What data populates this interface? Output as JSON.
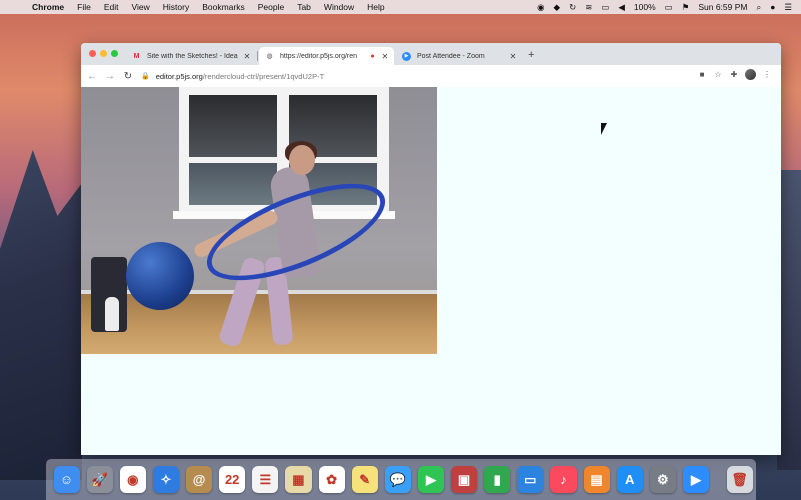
{
  "menubar": {
    "app_name": "Chrome",
    "items": [
      "File",
      "Edit",
      "View",
      "History",
      "Bookmarks",
      "People",
      "Tab",
      "Window",
      "Help"
    ],
    "battery": "100%",
    "clock": "Sun 6:59 PM"
  },
  "browser": {
    "tabs": [
      {
        "label": "Site with the Sketches! - Idea",
        "favicon": "gmail-icon",
        "active": false
      },
      {
        "label": "https://editor.p5js.org/ren",
        "favicon": "globe-icon",
        "active": true,
        "recording": true
      },
      {
        "label": "Post Attendee - Zoom",
        "favicon": "zoom-icon",
        "active": false
      }
    ],
    "new_tab_label": "+",
    "address": {
      "host": "editor.p5js.org",
      "path": "/rendercloud-ctrl/present/1qvdU2P-T"
    }
  },
  "page": {
    "background": "#f2fffe",
    "video_description_name": "webcam-video"
  },
  "dock": {
    "apps": [
      {
        "name": "finder-icon",
        "color": "#3d8ef0",
        "glyph": "☺"
      },
      {
        "name": "launchpad-icon",
        "color": "#8a8f9a",
        "glyph": "🚀"
      },
      {
        "name": "chrome-icon",
        "color": "#ffffff",
        "glyph": "◉"
      },
      {
        "name": "safari-icon",
        "color": "#2f7be0",
        "glyph": "✧"
      },
      {
        "name": "contacts-icon",
        "color": "#b58b4f",
        "glyph": "@"
      },
      {
        "name": "calendar-icon",
        "color": "#ffffff",
        "glyph": "22"
      },
      {
        "name": "reminders-icon",
        "color": "#f4f4f4",
        "glyph": "☰"
      },
      {
        "name": "preview-icon",
        "color": "#e8d9a8",
        "glyph": "▦"
      },
      {
        "name": "photos-icon",
        "color": "#ffffff",
        "glyph": "✿"
      },
      {
        "name": "notes-icon",
        "color": "#f6e27a",
        "glyph": "✎"
      },
      {
        "name": "messages-icon",
        "color": "#3aa0f7",
        "glyph": "💬"
      },
      {
        "name": "facetime-icon",
        "color": "#2fc554",
        "glyph": "▶"
      },
      {
        "name": "photo-booth-icon",
        "color": "#c04040",
        "glyph": "▣"
      },
      {
        "name": "numbers-icon",
        "color": "#2fa84f",
        "glyph": "▮"
      },
      {
        "name": "keynote-icon",
        "color": "#2a84e0",
        "glyph": "▭"
      },
      {
        "name": "music-icon",
        "color": "#fb4a5e",
        "glyph": "♪"
      },
      {
        "name": "books-icon",
        "color": "#f0862c",
        "glyph": "▤"
      },
      {
        "name": "app-store-icon",
        "color": "#1f8ef5",
        "glyph": "A"
      },
      {
        "name": "system-preferences-icon",
        "color": "#777c85",
        "glyph": "⚙"
      },
      {
        "name": "zoom-icon",
        "color": "#2d8cff",
        "glyph": "▶"
      },
      {
        "name": "trash-icon",
        "color": "#d7dbe0",
        "glyph": "🗑"
      }
    ]
  }
}
